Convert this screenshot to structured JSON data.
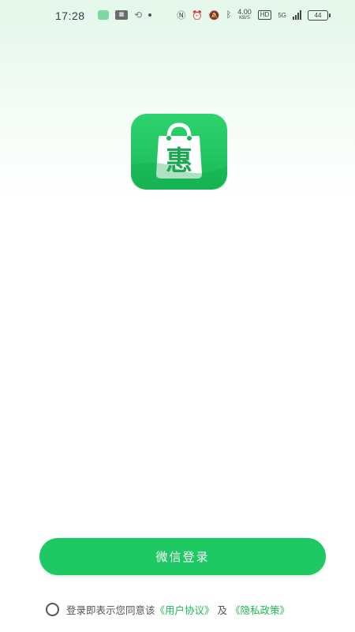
{
  "status_bar": {
    "time": "17:28",
    "net_speed_value": "4.00",
    "net_speed_unit": "KB/S",
    "hd_label": "HD",
    "network_label": "5G",
    "battery": "44",
    "icons": [
      "app-notification-icon",
      "app-badge-icon",
      "sync-icon",
      "dot-icon",
      "nfc-icon",
      "alarm-icon",
      "mute-icon",
      "bluetooth-icon",
      "signal-icon",
      "battery-icon"
    ]
  },
  "app": {
    "logo_char": "惠",
    "brand_color": "#1ec862"
  },
  "login": {
    "wechat_button_label": "微信登录"
  },
  "agreement": {
    "prefix": "登录即表示您同意该",
    "user_agreement_link": "《用户协议》",
    "conjunction": "及",
    "privacy_policy_link": "《隐私政策》",
    "checked": false
  }
}
